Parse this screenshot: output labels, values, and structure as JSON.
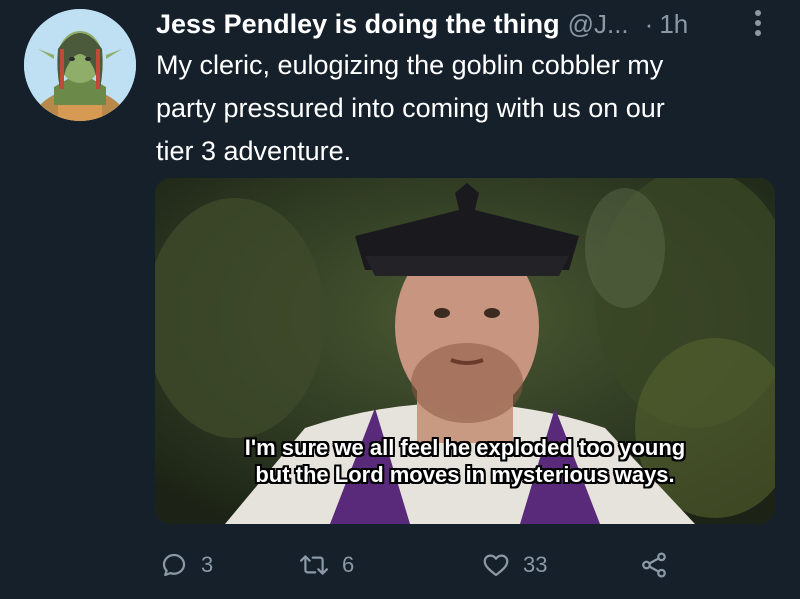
{
  "tweet": {
    "author": {
      "display_name": "Jess Pendley is doing the thing",
      "handle": "@J...",
      "separator": "·",
      "time": "1h",
      "avatar_icon": "avatar-image"
    },
    "text": "My cleric, eulogizing the goblin cobbler my\nparty pressured into coming with us on our\ntier 3 adventure.",
    "media": {
      "subtitle": "I'm sure we all feel he exploded too young\nbut the Lord moves in mysterious ways."
    },
    "actions": {
      "reply": {
        "icon": "reply-icon",
        "count": "3"
      },
      "retweet": {
        "icon": "retweet-icon",
        "count": "6"
      },
      "like": {
        "icon": "heart-icon",
        "count": "33"
      },
      "share": {
        "icon": "share-icon"
      }
    },
    "more_icon": "more-icon"
  },
  "colors": {
    "background": "#15202b",
    "primary_text": "#ffffff",
    "secondary_text": "#8b98a5"
  }
}
